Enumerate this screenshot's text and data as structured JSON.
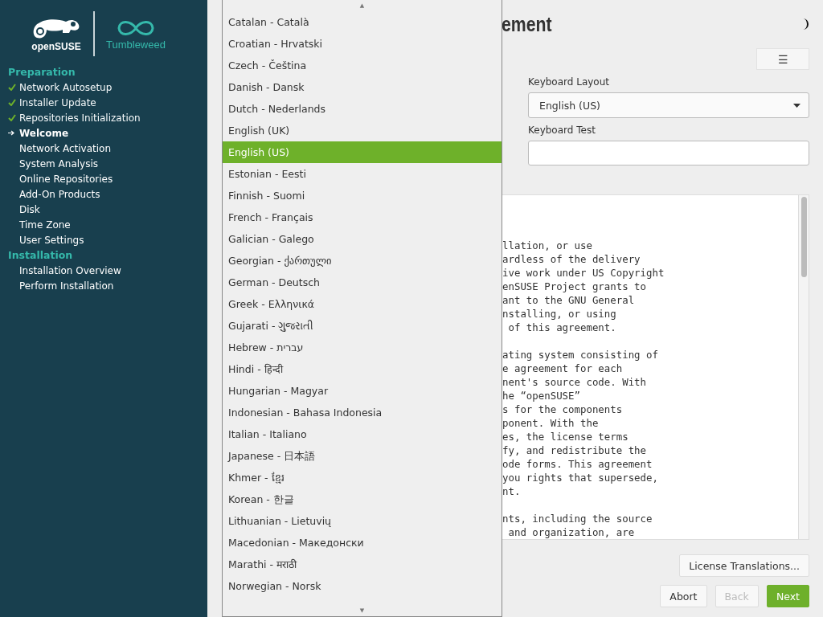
{
  "sidebar": {
    "product": "Tumbleweed",
    "brand": "openSUSE",
    "sections": [
      {
        "title": "Preparation",
        "items": [
          {
            "label": "Network Autosetup",
            "done": true,
            "current": false
          },
          {
            "label": "Installer Update",
            "done": true,
            "current": false
          },
          {
            "label": "Repositories Initialization",
            "done": true,
            "current": false
          },
          {
            "label": "Welcome",
            "done": false,
            "current": true
          },
          {
            "label": "Network Activation",
            "done": false,
            "current": false
          },
          {
            "label": "System Analysis",
            "done": false,
            "current": false
          },
          {
            "label": "Online Repositories",
            "done": false,
            "current": false
          },
          {
            "label": "Add-On Products",
            "done": false,
            "current": false
          },
          {
            "label": "Disk",
            "done": false,
            "current": false
          },
          {
            "label": "Time Zone",
            "done": false,
            "current": false
          },
          {
            "label": "User Settings",
            "done": false,
            "current": false
          }
        ]
      },
      {
        "title": "Installation",
        "items": [
          {
            "label": "Installation Overview",
            "done": false,
            "current": false
          },
          {
            "label": "Perform Installation",
            "done": false,
            "current": false
          }
        ]
      }
    ]
  },
  "heading": "ement",
  "menu_button": "☰",
  "keyboard_layout": {
    "label": "Keyboard Layout",
    "value": "English (US)"
  },
  "keyboard_test": {
    "label": "Keyboard Test"
  },
  "license_text": [
    "llation, or use\nardless of the delivery\nive work under US Copyright\nenSUSE Project grants to\nant to the GNU General\nnstalling, or using\n of this agreement.",
    "ating system consisting of\ne agreement for each\nnent's source code. With\nhe “openSUSE”\ns for the components\nponent. With the\nes, the license terms\nfy, and redistribute the\node forms. This agreement\nyou rights that supersede,\nnt.",
    "nts, including the source\n and organization, are"
  ],
  "buttons": [
    {
      "label": "License Translations...",
      "kind": "plain",
      "disabled": false
    },
    {
      "label": "Abort",
      "kind": "plain",
      "disabled": false
    },
    {
      "label": "Back",
      "kind": "plain",
      "disabled": true
    },
    {
      "label": "Next",
      "kind": "primary",
      "disabled": false
    }
  ],
  "language_list": {
    "scroll_up": "▲",
    "scroll_down": "▼",
    "items": [
      {
        "label": "Catalan - Català",
        "selected": false
      },
      {
        "label": "Croatian - Hrvatski",
        "selected": false
      },
      {
        "label": "Czech - Čeština",
        "selected": false
      },
      {
        "label": "Danish - Dansk",
        "selected": false
      },
      {
        "label": "Dutch - Nederlands",
        "selected": false
      },
      {
        "label": "English (UK)",
        "selected": false
      },
      {
        "label": "English (US)",
        "selected": true
      },
      {
        "label": "Estonian - Eesti",
        "selected": false
      },
      {
        "label": "Finnish - Suomi",
        "selected": false
      },
      {
        "label": "French - Français",
        "selected": false
      },
      {
        "label": "Galician - Galego",
        "selected": false
      },
      {
        "label": "Georgian - ქართული",
        "selected": false
      },
      {
        "label": "German - Deutsch",
        "selected": false
      },
      {
        "label": "Greek - Ελληνικά",
        "selected": false
      },
      {
        "label": "Gujarati - ગુજરાતી",
        "selected": false
      },
      {
        "label": "Hebrew - עברית",
        "selected": false
      },
      {
        "label": "Hindi - हिन्दी",
        "selected": false
      },
      {
        "label": "Hungarian - Magyar",
        "selected": false
      },
      {
        "label": "Indonesian - Bahasa Indonesia",
        "selected": false
      },
      {
        "label": "Italian - Italiano",
        "selected": false
      },
      {
        "label": "Japanese - 日本語",
        "selected": false
      },
      {
        "label": "Khmer - ខ្មែរ",
        "selected": false
      },
      {
        "label": "Korean - 한글",
        "selected": false
      },
      {
        "label": "Lithuanian - Lietuvių",
        "selected": false
      },
      {
        "label": "Macedonian - Македонски",
        "selected": false
      },
      {
        "label": "Marathi - मराठी",
        "selected": false
      },
      {
        "label": "Norwegian - Norsk",
        "selected": false
      }
    ]
  }
}
